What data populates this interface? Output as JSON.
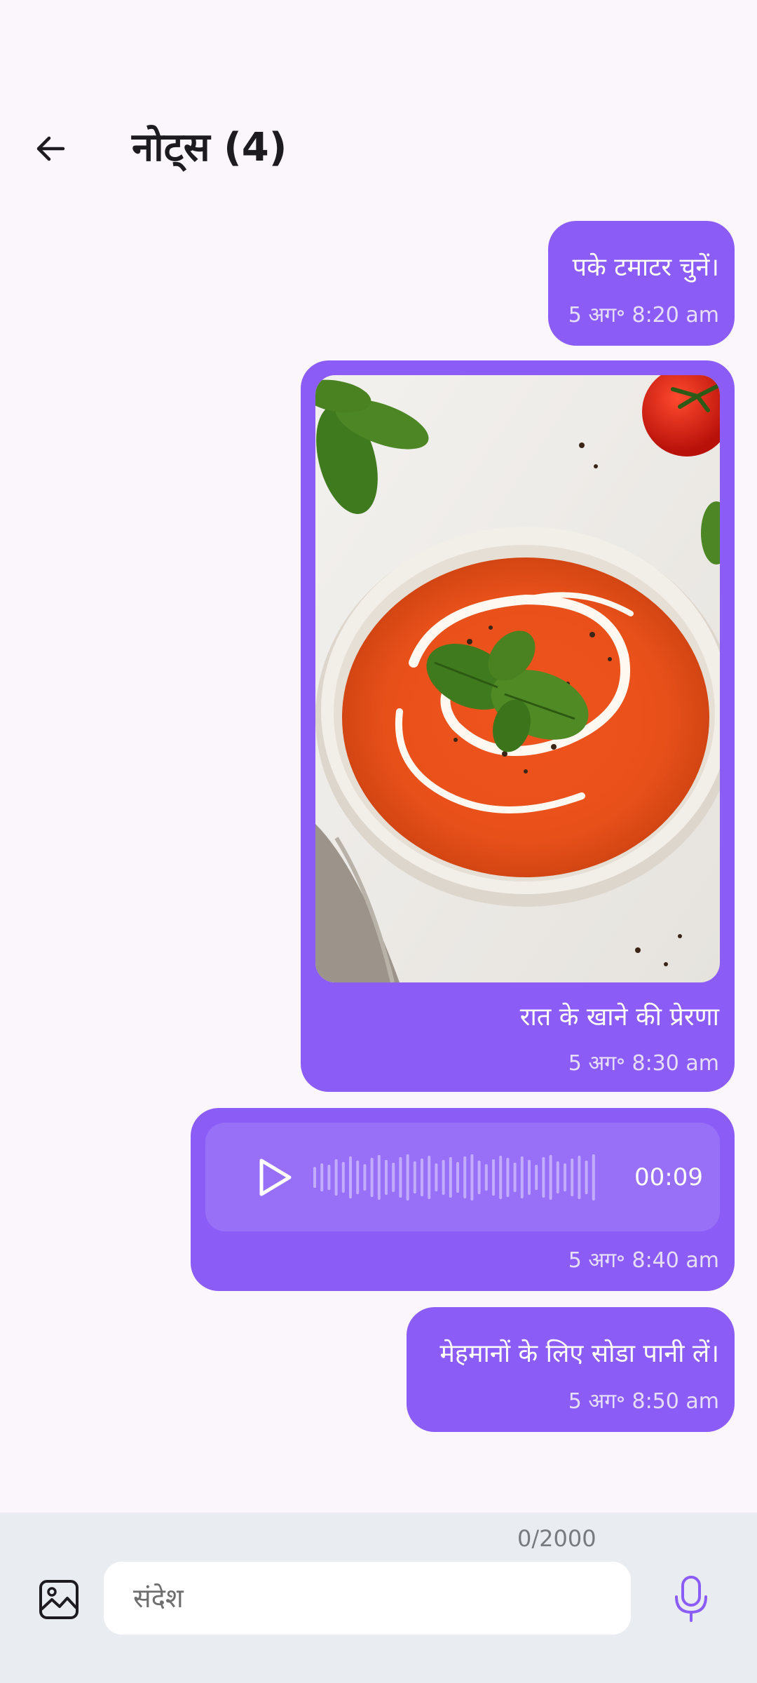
{
  "header": {
    "title": "नोट्स (4)"
  },
  "messages": [
    {
      "type": "text",
      "text": "पके टमाटर चुनें।",
      "time": "5 अग॰ 8:20 am"
    },
    {
      "type": "image",
      "caption": "रात के खाने की प्रेरणा",
      "time": "5 अग॰ 8:30 am",
      "image": "tomato-soup-bowl-with-basil"
    },
    {
      "type": "audio",
      "duration": "00:09",
      "time": "5 अग॰ 8:40 am"
    },
    {
      "type": "text",
      "text": "मेहमानों के लिए सोडा पानी लें।",
      "time": "5 अग॰ 8:50 am"
    }
  ],
  "composer": {
    "counter": "0/2000",
    "placeholder": "संदेश"
  },
  "icons": {
    "back": "arrow-left-icon",
    "gallery": "image-icon",
    "mic": "microphone-icon",
    "play": "play-icon"
  },
  "colors": {
    "bubble": "#8b5cf6",
    "background": "#fbf5fc",
    "accent": "#8b5cf6"
  }
}
